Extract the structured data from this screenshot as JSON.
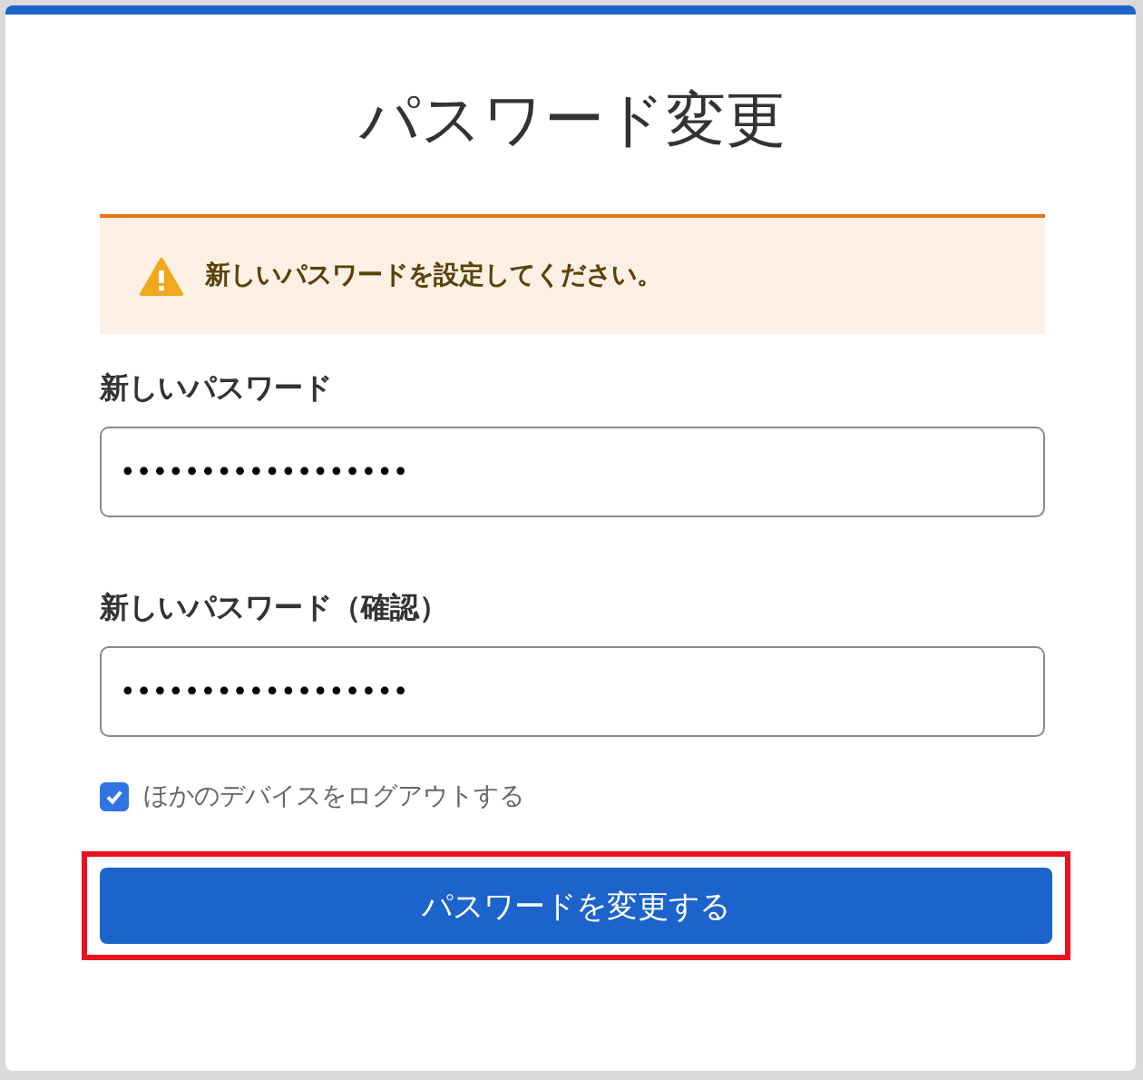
{
  "title": "パスワード変更",
  "alert": {
    "kind": "warning",
    "message": "新しいパスワードを設定してください。"
  },
  "fields": [
    {
      "label": "新しいパスワード",
      "value": "••••••••••••••••••"
    },
    {
      "label": "新しいパスワード（確認）",
      "value": "••••••••••••••••••"
    }
  ],
  "logout_others": {
    "label": "ほかのデバイスをログアウトする",
    "checked": true
  },
  "submit": {
    "label": "パスワードを変更する",
    "highlighted": true
  }
}
